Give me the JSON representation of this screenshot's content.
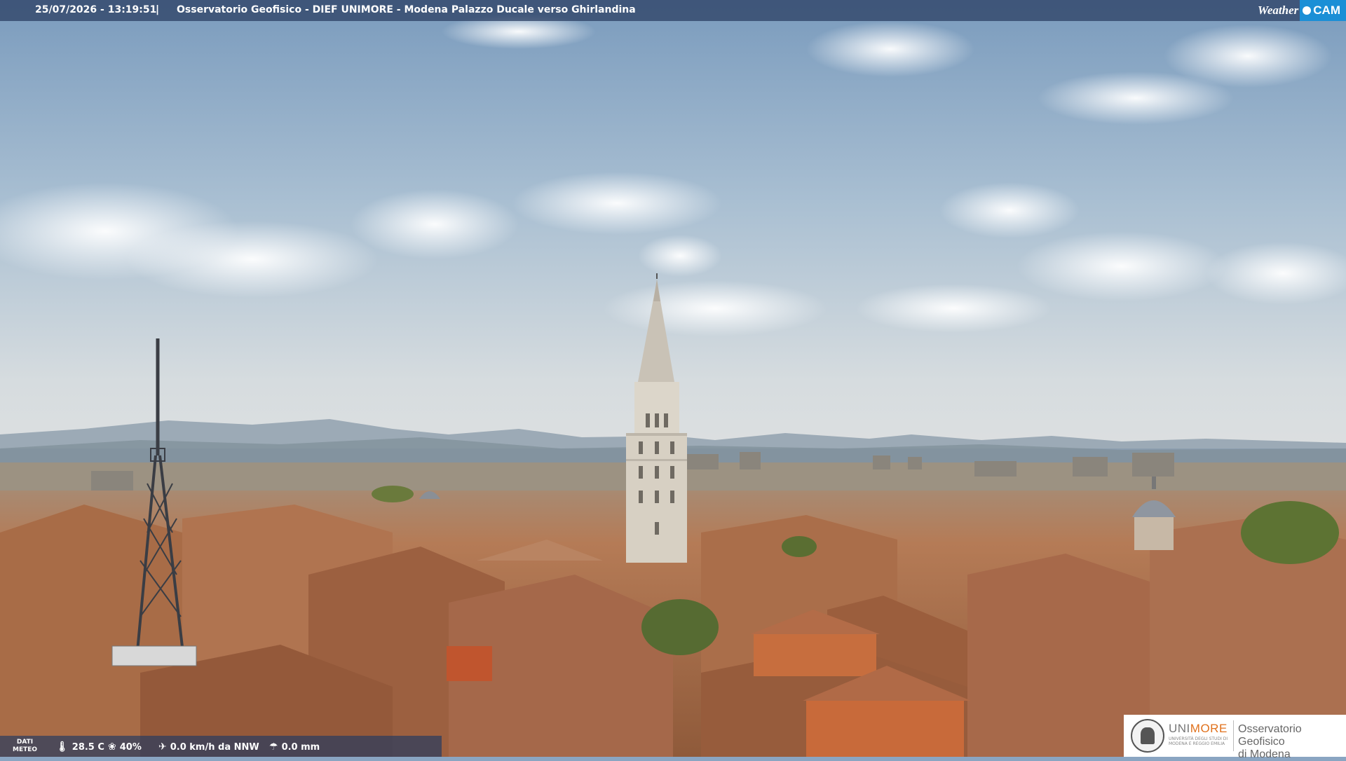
{
  "overlay": {
    "timestamp": "25/07/2026 - 13:19:51",
    "separator": "|",
    "location": "Osservatorio Geofisico - DIEF UNIMORE - Modena Palazzo Ducale verso Ghirlandina",
    "brand_weather": "Weather",
    "brand_cam": "CAM"
  },
  "weather": {
    "label_line1": "DATI",
    "label_line2": "METEO",
    "temperature": "28.5 C",
    "humidity": "40%",
    "wind": "0.0 km/h da NNW",
    "rain": "0.0 mm"
  },
  "logo": {
    "uni_part1": "UNI",
    "uni_part2": "MORE",
    "uni_sub": "UNIVERSITÀ DEGLI STUDI DI MODENA E REGGIO EMILIA",
    "observatory_line1": "Osservatorio Geofisico",
    "observatory_line2": "di Modena"
  },
  "colors": {
    "sky_top": "#7f9fbf",
    "sky_horizon": "#d8dde0",
    "roofs": "#b9794f",
    "tower": "#d8d2c6",
    "accent_orange": "#e0711c",
    "brand_blue": "#1b8fd6"
  }
}
